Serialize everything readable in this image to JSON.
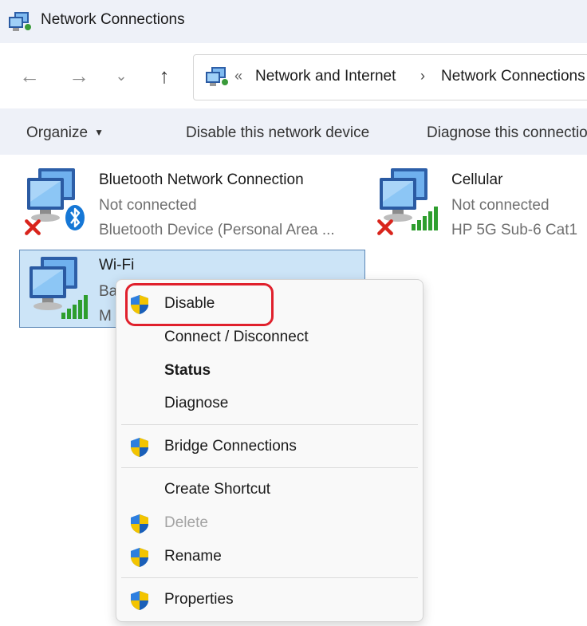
{
  "window": {
    "title": "Network Connections"
  },
  "address_bar": {
    "overflow_chevron": "«",
    "breadcrumbs": [
      "Network and Internet",
      "Network Connections"
    ],
    "separator": "›"
  },
  "commands": {
    "organize": "Organize",
    "disable_device": "Disable this network device",
    "diagnose": "Diagnose this connection"
  },
  "connections": [
    {
      "name": "Bluetooth Network Connection",
      "status": "Not connected",
      "device": "Bluetooth Device (Personal Area ...",
      "icon": "bluetooth-network-icon",
      "state_icon": "disconnected-x-icon"
    },
    {
      "name": "Cellular",
      "status": "Not connected",
      "device": "HP 5G Sub-6 Cat1",
      "icon": "cellular-network-icon",
      "state_icon": "disconnected-x-icon"
    },
    {
      "name": "Wi-Fi",
      "status": "Ba",
      "device": "M",
      "icon": "wifi-network-icon",
      "selected": true
    }
  ],
  "context_menu": {
    "items": [
      {
        "label": "Disable",
        "shield": true,
        "bold": false,
        "disabled": false
      },
      {
        "label": "Connect / Disconnect",
        "shield": false,
        "bold": false,
        "disabled": false
      },
      {
        "label": "Status",
        "shield": false,
        "bold": true,
        "disabled": false
      },
      {
        "label": "Diagnose",
        "shield": false,
        "bold": false,
        "disabled": false
      },
      {
        "label": "Bridge Connections",
        "shield": true,
        "bold": false,
        "disabled": false
      },
      {
        "label": "Create Shortcut",
        "shield": false,
        "bold": false,
        "disabled": false
      },
      {
        "label": "Delete",
        "shield": true,
        "bold": false,
        "disabled": true
      },
      {
        "label": "Rename",
        "shield": true,
        "bold": false,
        "disabled": false
      },
      {
        "label": "Properties",
        "shield": true,
        "bold": false,
        "disabled": false
      }
    ],
    "highlighted_item": "Disable"
  },
  "colors": {
    "titlebar_bg": "#eef1f8",
    "selection_bg": "#cce4f7",
    "selection_border": "#5b87b6",
    "highlight_outline": "#e0202c",
    "signal_green": "#2e9e2e",
    "disconnected_red": "#d9241c",
    "shield_blue": "#1f6fd1",
    "shield_yellow": "#f3c400"
  }
}
